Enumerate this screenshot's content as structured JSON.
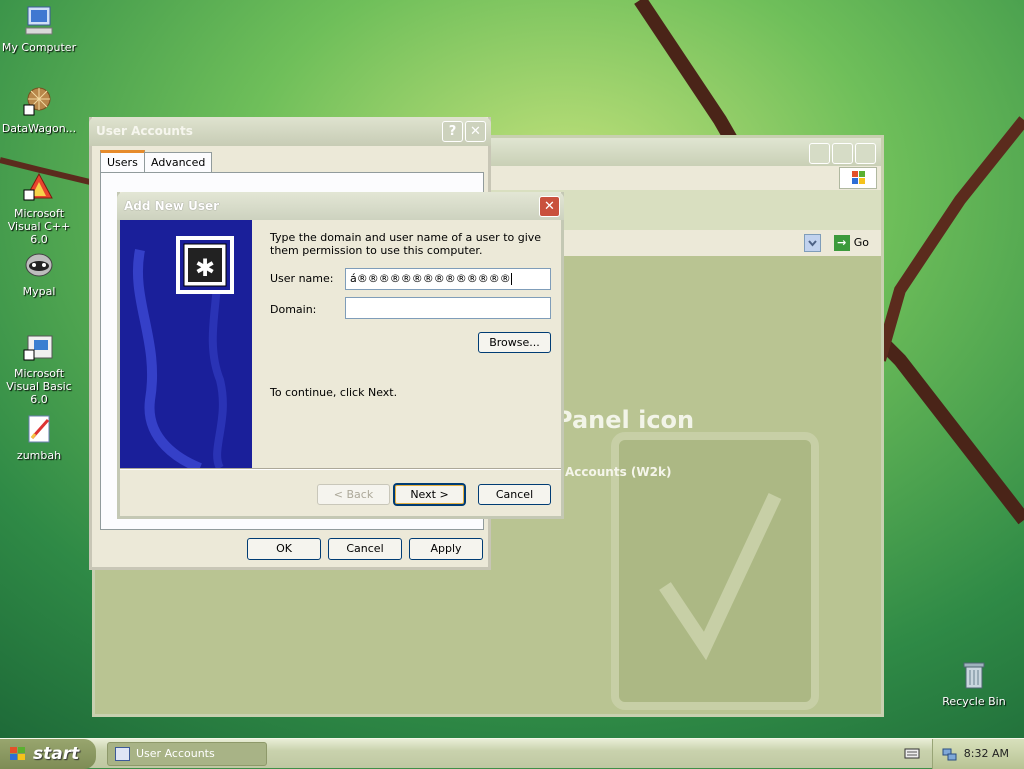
{
  "desktop": {
    "icons": [
      {
        "label": "My Computer",
        "icon": "my-computer-icon"
      },
      {
        "label": "DataWagon...",
        "icon": "datawagon-icon"
      },
      {
        "label": "Microsoft Visual C++ 6.0",
        "icon": "visual-cpp-icon"
      },
      {
        "label": "Mypal",
        "icon": "mypal-icon"
      },
      {
        "label": "Microsoft Visual Basic 6.0",
        "icon": "visual-basic-icon"
      },
      {
        "label": "zumbah",
        "icon": "zumbah-icon"
      },
      {
        "label": "Recycle Bin",
        "icon": "recycle-bin-icon"
      }
    ]
  },
  "control_panel_window": {
    "go_label": "Go",
    "heading": "Panel icon",
    "subheading": "Accounts (W2k)"
  },
  "user_accounts_dialog": {
    "title": "User Accounts",
    "help_button": "?",
    "close_button": "✕",
    "tabs": [
      "Users",
      "Advanced"
    ],
    "buttons": {
      "ok": "OK",
      "cancel": "Cancel",
      "apply": "Apply"
    }
  },
  "add_new_user_dialog": {
    "title": "Add New User",
    "close_button": "✕",
    "description": "Type the domain and user name of a user to give them permission to use this computer.",
    "user_name_label": "User name:",
    "user_name_value": "á®®®®®®®®®®®®®®",
    "domain_label": "Domain:",
    "domain_value": "",
    "browse_label": "Browse...",
    "continue_text": "To continue, click Next.",
    "back_label": "< Back",
    "next_label": "Next >",
    "cancel_label": "Cancel"
  },
  "taskbar": {
    "start_label": "start",
    "task_button_label": "User Accounts",
    "clock": "8:32 AM"
  },
  "colors": {
    "wallpaper_green": "#3f8f48",
    "banner_blue": "#1a1f9a",
    "xp_close_red": "#c9513d"
  }
}
